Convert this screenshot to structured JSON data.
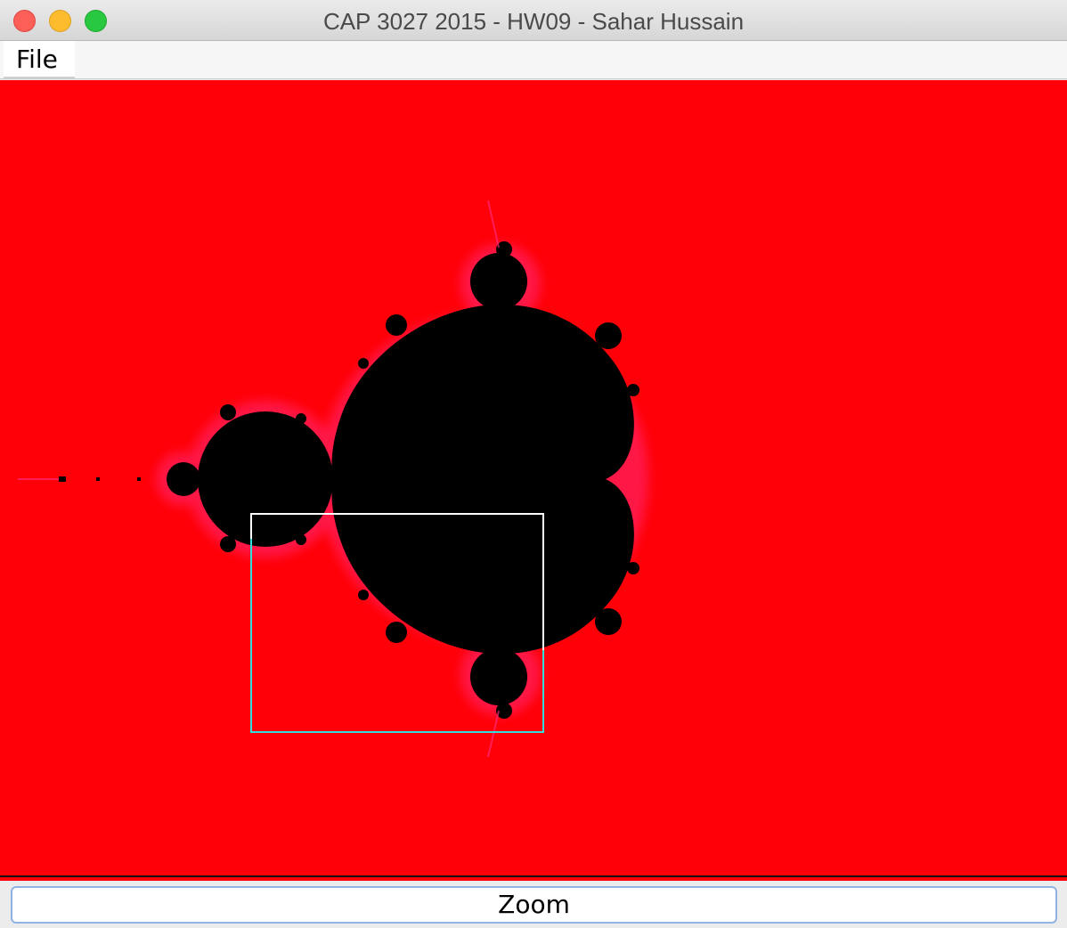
{
  "window": {
    "title": "CAP 3027 2015 - HW09 - Sahar Hussain"
  },
  "menubar": {
    "file_label": "File"
  },
  "fractal": {
    "background_color": "#ff0008",
    "set_color": "#000000",
    "fringe_color": "#ff1a6e",
    "selection_stroke_top": "#ffffff",
    "selection_stroke_bottom": "#33dddd"
  },
  "zoom": {
    "label": "Zoom"
  },
  "icons": {
    "close": "close-icon",
    "minimize": "minimize-icon",
    "maximize": "maximize-icon"
  }
}
